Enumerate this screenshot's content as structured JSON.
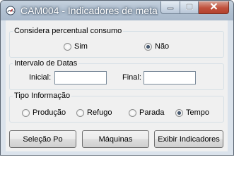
{
  "window": {
    "title": "CAM004 - Indicadores de meta...",
    "buttons": [
      "minimize-icon",
      "maximize-icon",
      "close-icon"
    ]
  },
  "consumo": {
    "legend": "Considera percentual consumo",
    "options": [
      {
        "label": "Sim",
        "checked": false
      },
      {
        "label": "Não",
        "checked": true
      }
    ]
  },
  "datas": {
    "legend": "Intervalo de Datas",
    "inicial_label": "Inicial:",
    "inicial_value": "",
    "final_label": "Final:",
    "final_value": ""
  },
  "tipo": {
    "legend": "Tipo Informação",
    "options": [
      {
        "label": "Produção",
        "checked": false
      },
      {
        "label": "Refugo",
        "checked": false
      },
      {
        "label": "Parada",
        "checked": false
      },
      {
        "label": "Tempo",
        "checked": true
      }
    ]
  },
  "actions": {
    "selecao_label": "Seleção Po",
    "maquinas_label": "Máquinas",
    "exibir_label": "Exibir Indicadores"
  },
  "colors": {
    "titlebar": "#b3c2d2",
    "client": "#f0f0f0",
    "close_button": "#c0503c"
  }
}
